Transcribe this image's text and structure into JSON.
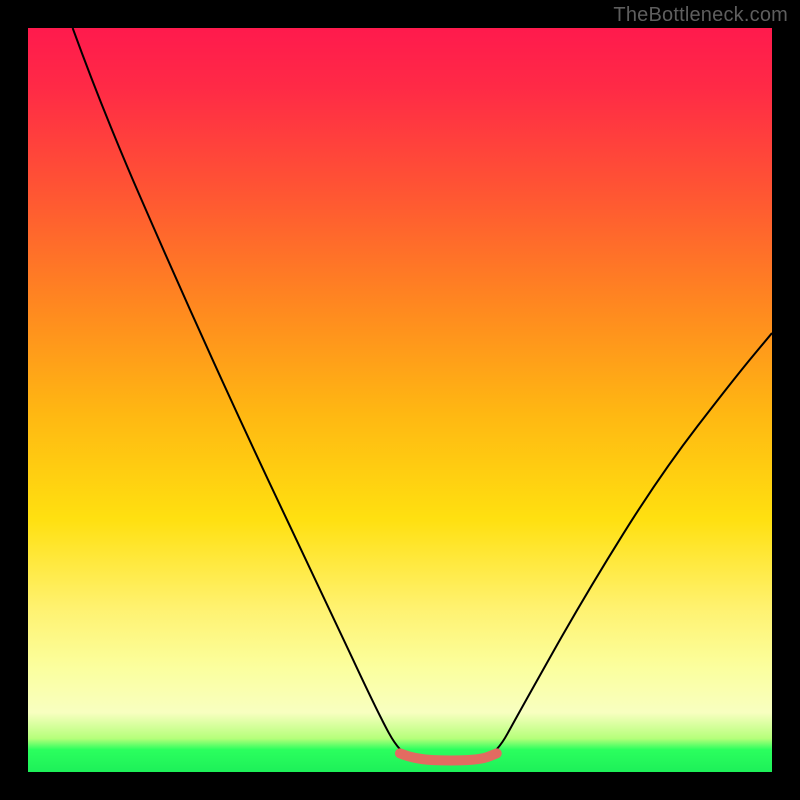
{
  "watermark_text": "TheBottleneck.com",
  "chart_data": {
    "type": "line",
    "title": "",
    "xlabel": "",
    "ylabel": "",
    "xlim": [
      0,
      100
    ],
    "ylim": [
      0,
      100
    ],
    "background_gradient_stops": [
      {
        "pos": 0,
        "color": "#ff1a4d"
      },
      {
        "pos": 22,
        "color": "#ff5533"
      },
      {
        "pos": 52,
        "color": "#ffb812"
      },
      {
        "pos": 78,
        "color": "#fff270"
      },
      {
        "pos": 97,
        "color": "#2bff5e"
      },
      {
        "pos": 100,
        "color": "#1df059"
      }
    ],
    "series": [
      {
        "name": "black-v-curve",
        "stroke": "#000000",
        "stroke_width": 2,
        "points": [
          {
            "x": 6,
            "y": 100
          },
          {
            "x": 10,
            "y": 89
          },
          {
            "x": 20,
            "y": 66
          },
          {
            "x": 30,
            "y": 44
          },
          {
            "x": 40,
            "y": 23
          },
          {
            "x": 47,
            "y": 8
          },
          {
            "x": 50,
            "y": 2.5
          },
          {
            "x": 53,
            "y": 1.5
          },
          {
            "x": 60,
            "y": 1.5
          },
          {
            "x": 63,
            "y": 2.5
          },
          {
            "x": 66,
            "y": 8
          },
          {
            "x": 75,
            "y": 24
          },
          {
            "x": 85,
            "y": 40
          },
          {
            "x": 95,
            "y": 53
          },
          {
            "x": 100,
            "y": 59
          }
        ]
      },
      {
        "name": "salmon-flat-bottom",
        "stroke": "#e26b61",
        "stroke_width": 10,
        "linecap": "round",
        "points": [
          {
            "x": 50,
            "y": 2.5
          },
          {
            "x": 52,
            "y": 1.7
          },
          {
            "x": 57,
            "y": 1.5
          },
          {
            "x": 61,
            "y": 1.7
          },
          {
            "x": 63,
            "y": 2.5
          }
        ]
      }
    ]
  }
}
